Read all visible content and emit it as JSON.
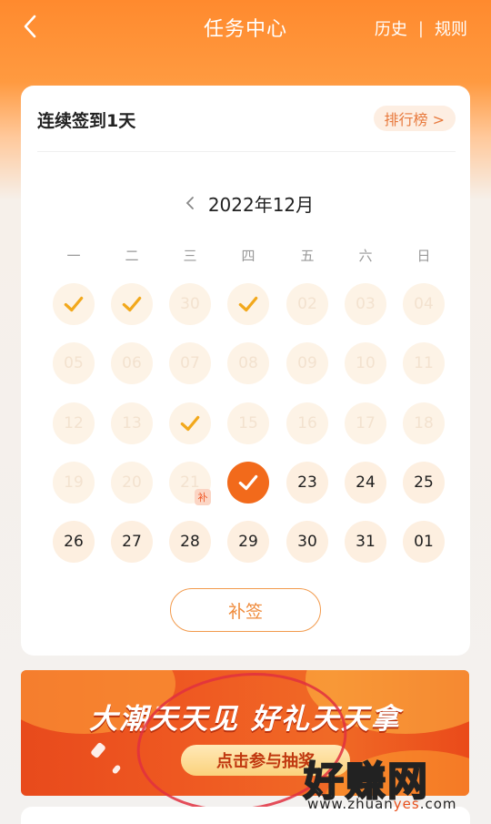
{
  "header": {
    "title": "任务中心",
    "history": "历史",
    "separator": "|",
    "rules": "规则"
  },
  "checkin": {
    "streak_text": "连续签到1天",
    "ranking_label": "排行榜 >",
    "month_label": "2022年12月",
    "weekdays": [
      "一",
      "二",
      "三",
      "四",
      "五",
      "六",
      "日"
    ],
    "days": [
      {
        "label": "",
        "state": "checked"
      },
      {
        "label": "",
        "state": "checked"
      },
      {
        "label": "30",
        "state": "missed"
      },
      {
        "label": "",
        "state": "checked"
      },
      {
        "label": "02",
        "state": "missed"
      },
      {
        "label": "03",
        "state": "missed"
      },
      {
        "label": "04",
        "state": "missed"
      },
      {
        "label": "05",
        "state": "missed"
      },
      {
        "label": "06",
        "state": "missed"
      },
      {
        "label": "07",
        "state": "missed"
      },
      {
        "label": "08",
        "state": "missed"
      },
      {
        "label": "09",
        "state": "missed"
      },
      {
        "label": "10",
        "state": "missed"
      },
      {
        "label": "11",
        "state": "missed"
      },
      {
        "label": "12",
        "state": "missed"
      },
      {
        "label": "13",
        "state": "missed"
      },
      {
        "label": "",
        "state": "checked"
      },
      {
        "label": "15",
        "state": "missed"
      },
      {
        "label": "16",
        "state": "missed"
      },
      {
        "label": "17",
        "state": "missed"
      },
      {
        "label": "18",
        "state": "missed"
      },
      {
        "label": "19",
        "state": "missed"
      },
      {
        "label": "20",
        "state": "missed"
      },
      {
        "label": "21",
        "state": "missed",
        "badge": "补"
      },
      {
        "label": "",
        "state": "today-checked"
      },
      {
        "label": "23",
        "state": "future"
      },
      {
        "label": "24",
        "state": "future"
      },
      {
        "label": "25",
        "state": "future"
      },
      {
        "label": "26",
        "state": "future"
      },
      {
        "label": "27",
        "state": "future"
      },
      {
        "label": "28",
        "state": "future"
      },
      {
        "label": "29",
        "state": "future"
      },
      {
        "label": "30",
        "state": "future"
      },
      {
        "label": "31",
        "state": "future"
      },
      {
        "label": "01",
        "state": "future"
      }
    ],
    "makeup_button": "补签"
  },
  "banner": {
    "slogan": "大潮天天见  好礼天天拿",
    "cta": "点击参与抽奖"
  },
  "watermark": {
    "brand": "好赚网",
    "url_pre": "www.zhuan",
    "url_hl": "yes",
    "url_post": ".com"
  },
  "colors": {
    "header_orange": "#ff8a2e",
    "accent": "#f26a1b",
    "check_gold": "#f2a81c",
    "missed_text": "#f3e2cf"
  }
}
